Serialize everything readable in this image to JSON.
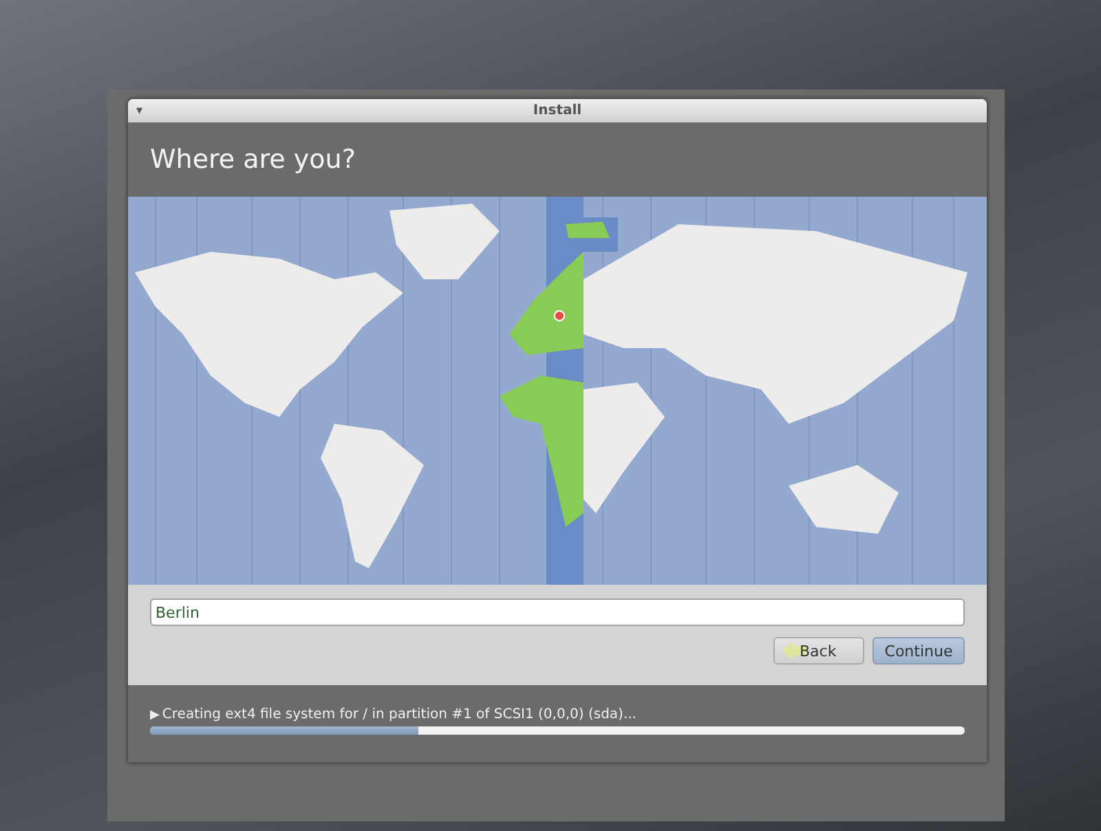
{
  "window": {
    "title": "Install",
    "menu_glyph": "▾"
  },
  "heading": "Where are you?",
  "location_field": {
    "value": "Berlin"
  },
  "buttons": [
    {
      "kind": "back",
      "label": "Back"
    },
    {
      "kind": "primary",
      "label": "Continue"
    }
  ],
  "status": {
    "glyph": "▶",
    "text": "Creating ext4 file system for / in partition #1 of SCSI1 (0,0,0) (sda)...",
    "level": 0.33
  }
}
